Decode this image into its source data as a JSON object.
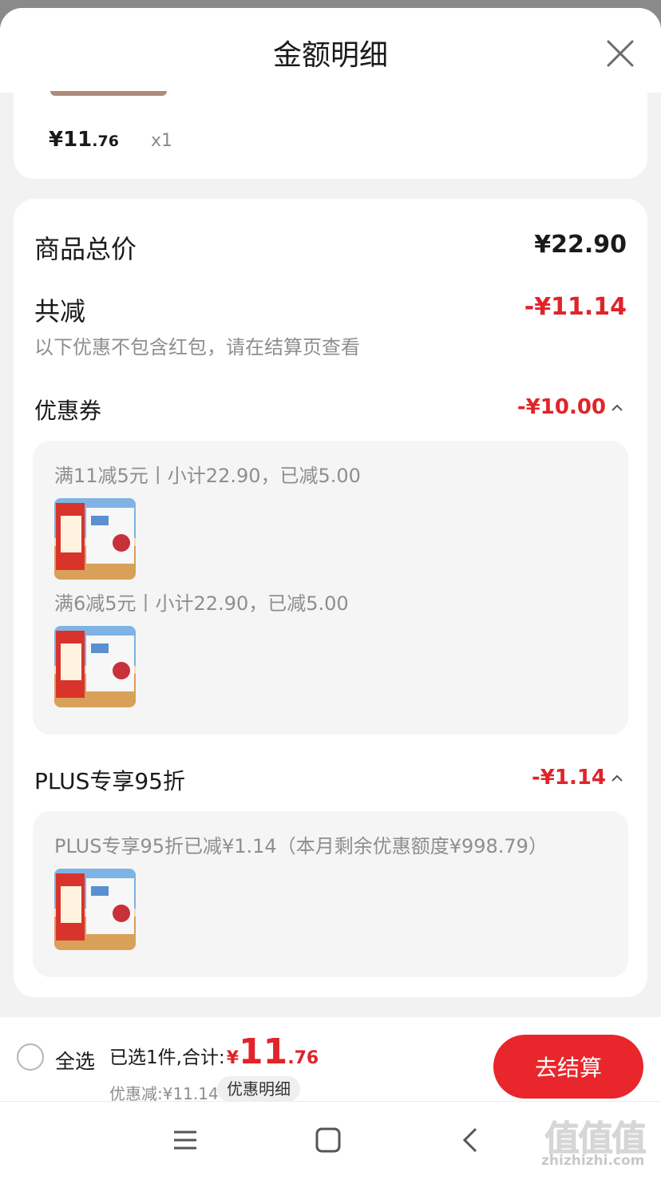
{
  "header": {
    "title": "金额明细"
  },
  "item": {
    "price_main": "¥11",
    "price_decimal": ".76",
    "quantity": "x1"
  },
  "summary": {
    "goods_total_label": "商品总价",
    "goods_total_value": "¥22.90",
    "total_reduction_label": "共减",
    "total_reduction_value": "-¥11.14",
    "note": "以下优惠不包含红包，请在结算页查看"
  },
  "coupons": {
    "label": "优惠券",
    "value": "-¥10.00",
    "entries": [
      {
        "text": "满11减5元丨小计22.90，已减5.00"
      },
      {
        "text": "满6减5元丨小计22.90，已减5.00"
      }
    ]
  },
  "plus": {
    "label": "PLUS专享95折",
    "value": "-¥1.14",
    "entries": [
      {
        "text": "PLUS专享95折已减¥1.14（本月剩余优惠额度¥998.79）"
      }
    ]
  },
  "footer": {
    "select_all": "全选",
    "selected_label": "已选1件,合计:",
    "currency": "¥",
    "total_int": "11",
    "total_dec": ".76",
    "discount_text": "优惠减:¥11.14",
    "detail_chip": "优惠明细",
    "checkout": "去结算"
  },
  "watermark": {
    "text": "zhizhizhi.com",
    "mark": "值值值"
  },
  "icons": {
    "close": "close-icon",
    "chevron": "chevron-up-icon",
    "menu": "menu-icon",
    "home": "home-icon",
    "back": "back-icon"
  },
  "colors": {
    "accent": "#e0242a",
    "checkout": "#e8262b"
  }
}
